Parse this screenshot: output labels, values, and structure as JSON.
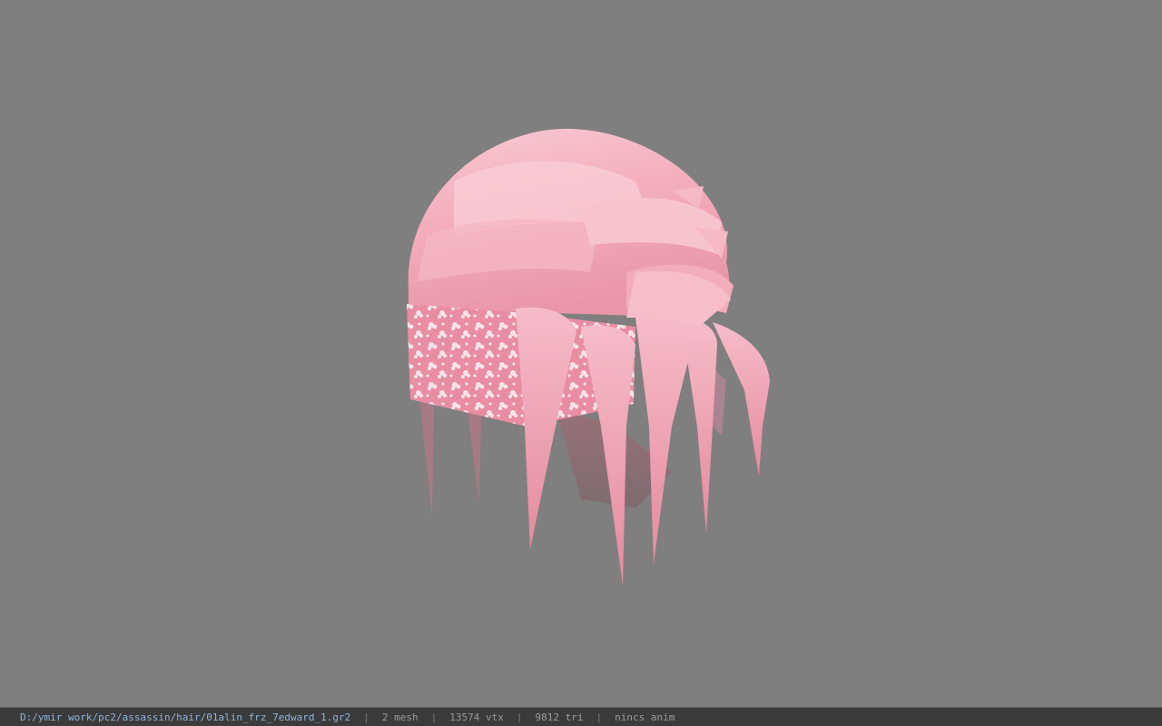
{
  "viewer": {
    "background_color": "#7f7f7f",
    "model": {
      "name": "01alin_frz_7edward_1.gr2",
      "hair_color": "#f2a8b8",
      "band_color": "#e88aa0",
      "band_pattern_color": "#ffffff"
    }
  },
  "status_bar": {
    "file_path": "D:/ymir work/pc2/assassin/hair/01alin_frz_7edward_1.gr2",
    "mesh_count": "2 mesh",
    "vertex_count": "13574 vtx",
    "triangle_count": "9812 tri",
    "animation": "nincs anim",
    "separator": "|"
  }
}
